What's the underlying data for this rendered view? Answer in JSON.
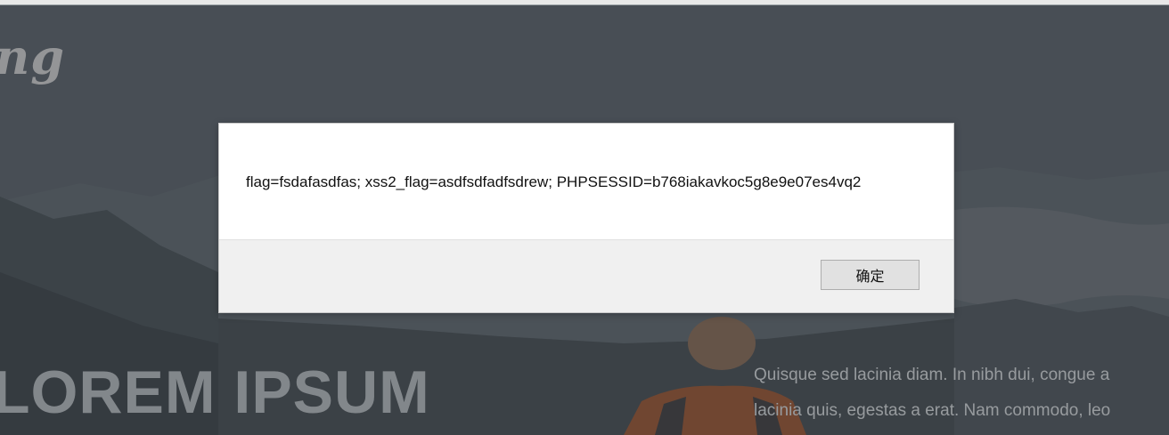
{
  "background": {
    "brand_text": "ng",
    "hero_title": "LOREM IPSUM",
    "hero_text_lines": [
      "Quisque sed lacinia diam. In nibh dui, congue a",
      "lacinia quis, egestas a erat. Nam commodo, leo"
    ]
  },
  "alert_dialog": {
    "message": "flag=fsdafasdfas; xss2_flag=asdfsdfadfsdrew; PHPSESSID=b768iakavkoc5g8e9e07es4vq2",
    "ok_label": "确定"
  },
  "colors": {
    "dialog_background": "#ffffff",
    "dialog_footer": "#f0f0f0",
    "button_background": "#e1e1e1",
    "page_overlay": "#4a5157"
  }
}
